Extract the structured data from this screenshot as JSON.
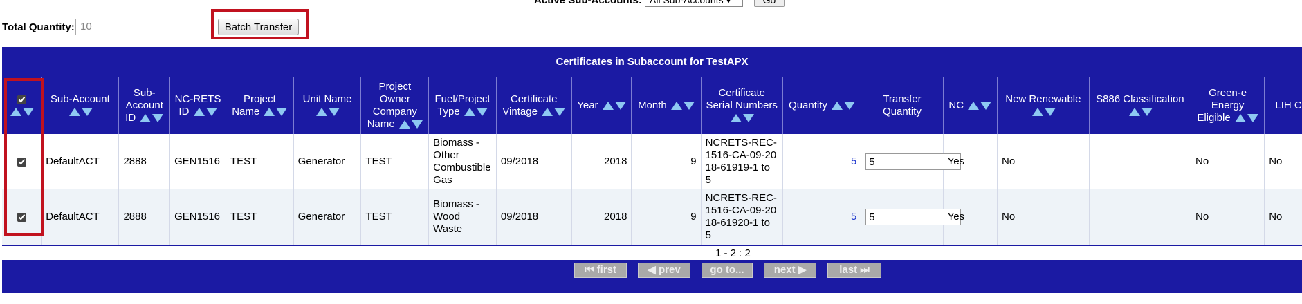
{
  "top": {
    "active_label": "Active Sub-Accounts:",
    "active_select": "All Sub-Accounts ▾",
    "go": "Go"
  },
  "quantity": {
    "label": "Total Quantity:",
    "value": "10",
    "batch_button": "Batch Transfer"
  },
  "table": {
    "title": "Certificates in Subaccount for TestAPX",
    "headers": [
      "Sub-Account",
      "Sub-Account ID",
      "NC-RETS ID",
      "Project Name",
      "Unit Name",
      "Project Owner Company Name",
      "Fuel/Project Type",
      "Certificate Vintage",
      "Year",
      "Month",
      "Certificate Serial Numbers",
      "Quantity",
      "Transfer Quantity",
      "NC",
      "New Renewable",
      "S886 Classification",
      "Green-e Energy Eligible",
      "LIH Certified"
    ],
    "rows": [
      {
        "sub_account": "DefaultACT",
        "sub_account_id": "2888",
        "ncrets_id": "GEN1516",
        "project_name": "TEST",
        "unit_name": "Generator",
        "owner": "TEST",
        "fuel_type": "Biomass - Other Combustible Gas",
        "vintage": "09/2018",
        "year": "2018",
        "month": "9",
        "serial": "NCRETS-REC-1516-CA-09-2018-61919-1 to 5",
        "quantity": "5",
        "transfer_qty": "5",
        "nc": "Yes",
        "new_renewable": "No",
        "s886": "",
        "green_e": "No",
        "lih": "No"
      },
      {
        "sub_account": "DefaultACT",
        "sub_account_id": "2888",
        "ncrets_id": "GEN1516",
        "project_name": "TEST",
        "unit_name": "Generator",
        "owner": "TEST",
        "fuel_type": "Biomass - Wood Waste",
        "vintage": "09/2018",
        "year": "2018",
        "month": "9",
        "serial": "NCRETS-REC-1516-CA-09-2018-61920-1 to 5",
        "quantity": "5",
        "transfer_qty": "5",
        "nc": "Yes",
        "new_renewable": "No",
        "s886": "",
        "green_e": "No",
        "lih": "No"
      }
    ]
  },
  "pager": {
    "count": "1 - 2 : 2",
    "first": "⏮ first",
    "prev": "◀ prev",
    "goto": "go to...",
    "next": "next ▶",
    "last": "last ⏭"
  }
}
